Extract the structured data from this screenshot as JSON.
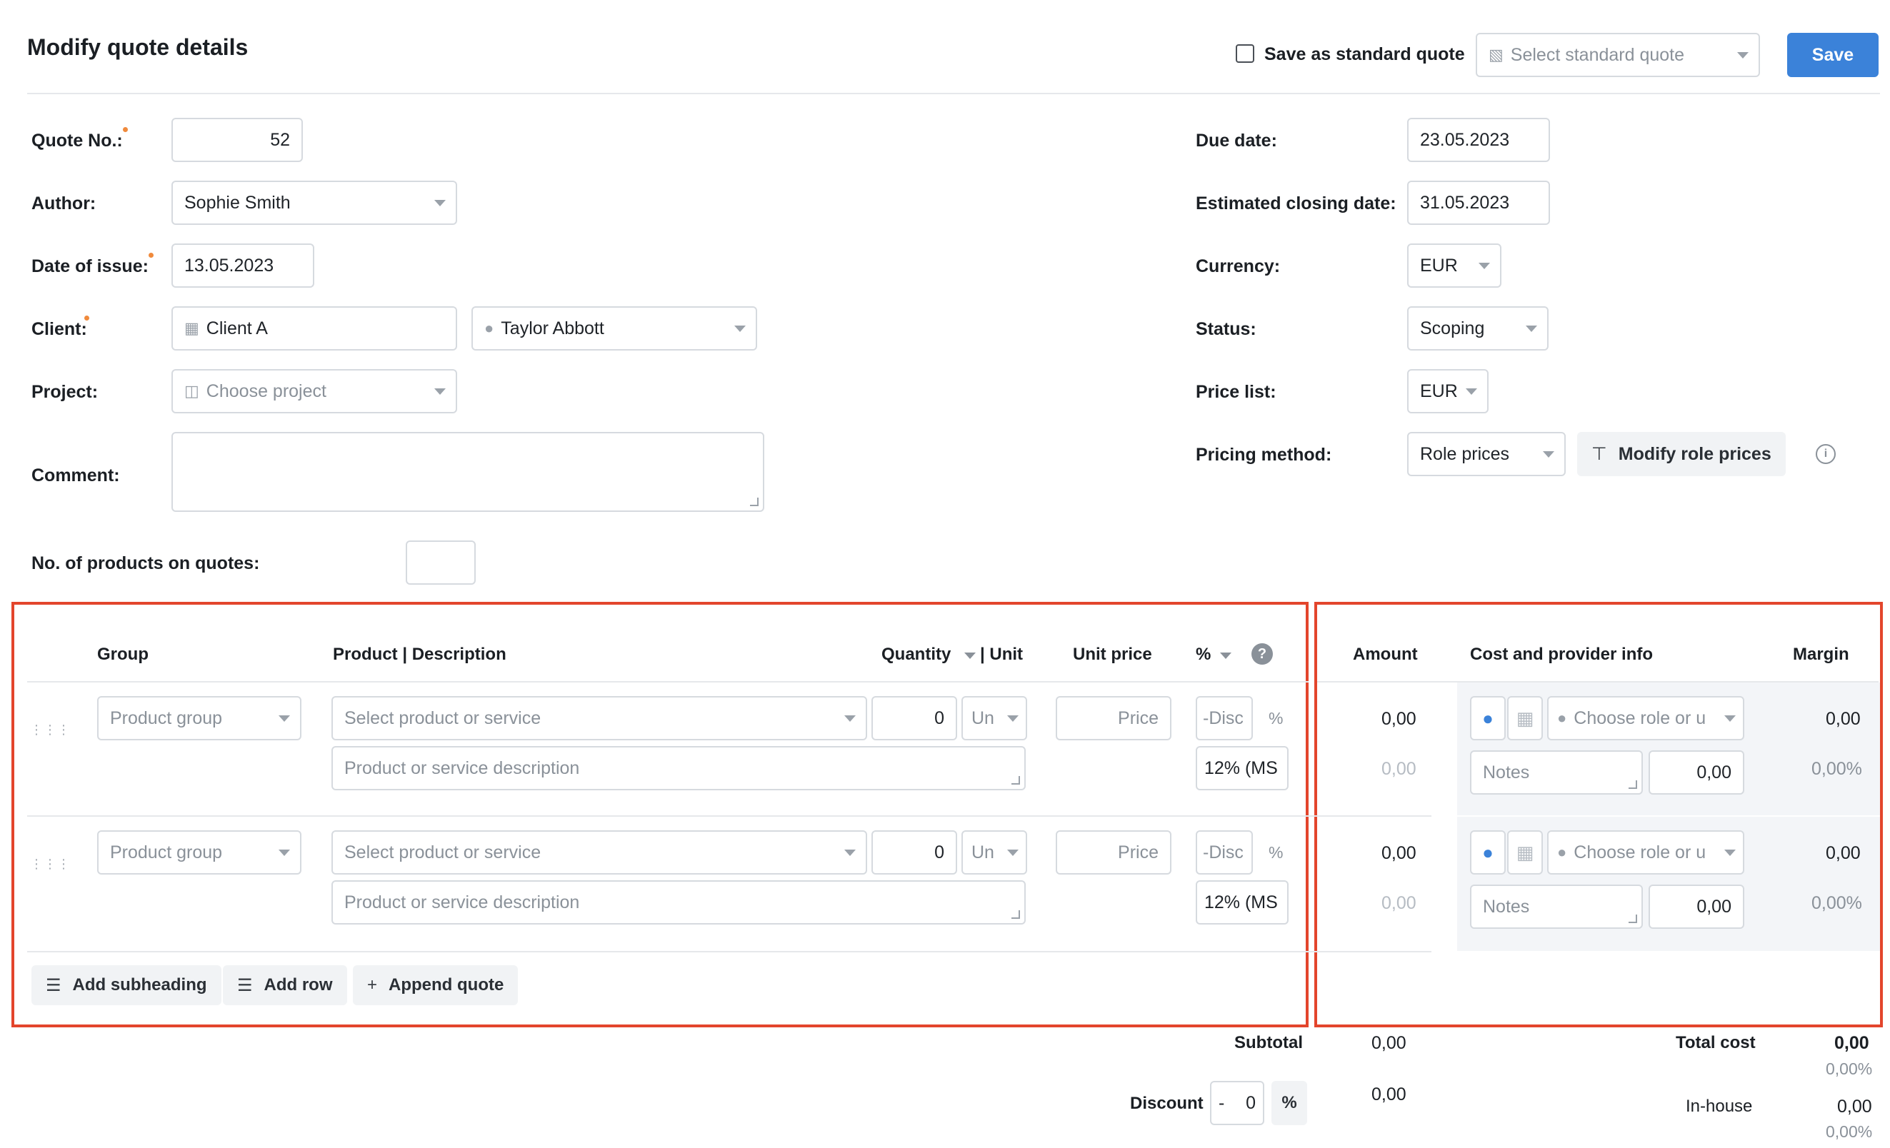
{
  "header": {
    "title": "Modify quote details",
    "save_standard_label": "Save as standard quote",
    "select_standard_placeholder": "Select standard quote",
    "save_label": "Save"
  },
  "form": {
    "quote_no_label": "Quote No.:",
    "quote_no_value": "52",
    "author_label": "Author:",
    "author_value": "Sophie Smith",
    "date_issue_label": "Date of issue:",
    "date_issue_value": "13.05.2023",
    "client_label": "Client:",
    "client_value": "Client A",
    "contact_value": "Taylor Abbott",
    "project_label": "Project:",
    "project_placeholder": "Choose project",
    "comment_label": "Comment:",
    "products_count_label": "No. of products on quotes:",
    "due_date_label": "Due date:",
    "due_date_value": "23.05.2023",
    "closing_date_label": "Estimated closing date:",
    "closing_date_value": "31.05.2023",
    "currency_label": "Currency:",
    "currency_value": "EUR",
    "status_label": "Status:",
    "status_value": "Scoping",
    "price_list_label": "Price list:",
    "price_list_value": "EUR",
    "pricing_method_label": "Pricing method:",
    "pricing_method_value": "Role prices",
    "modify_role_prices_label": "Modify role prices"
  },
  "table": {
    "headers": {
      "group": "Group",
      "product": "Product | Description",
      "quantity": "Quantity",
      "unit": "| Unit",
      "unit_price": "Unit price",
      "percent": "%",
      "help": "?",
      "amount": "Amount",
      "cost_info": "Cost and provider info",
      "margin": "Margin"
    },
    "rows": [
      {
        "group_placeholder": "Product group",
        "product_placeholder": "Select product or service",
        "quantity": "0",
        "unit_placeholder": "Un",
        "price_placeholder": "Price",
        "discount_placeholder": "-Disc",
        "percent_sign": "%",
        "description_placeholder": "Product or service description",
        "tax": "12% (MS",
        "amount": "0,00",
        "amount_sub": "0,00",
        "role_placeholder": "Choose role or u",
        "notes_placeholder": "Notes",
        "cost": "0,00",
        "margin": "0,00",
        "margin_pct": "0,00%"
      },
      {
        "group_placeholder": "Product group",
        "product_placeholder": "Select product or service",
        "quantity": "0",
        "unit_placeholder": "Un",
        "price_placeholder": "Price",
        "discount_placeholder": "-Disc",
        "percent_sign": "%",
        "description_placeholder": "Product or service description",
        "tax": "12% (MS",
        "amount": "0,00",
        "amount_sub": "0,00",
        "role_placeholder": "Choose role or u",
        "notes_placeholder": "Notes",
        "cost": "0,00",
        "margin": "0,00",
        "margin_pct": "0,00%"
      }
    ],
    "actions": {
      "add_subheading": "Add subheading",
      "add_row": "Add row",
      "append_quote": "Append quote"
    }
  },
  "totals": {
    "subtotal_label": "Subtotal",
    "subtotal_value": "0,00",
    "discount_label": "Discount",
    "discount_sign": "-",
    "discount_value": "0",
    "discount_unit": "%",
    "discount_amount": "0,00",
    "total_cost_label": "Total cost",
    "total_cost_value": "0,00",
    "total_cost_pct": "0,00%",
    "inhouse_label": "In-house",
    "inhouse_value": "0,00",
    "inhouse_pct": "0,00%"
  },
  "icons": {
    "building": "building-icon",
    "person": "person-icon",
    "briefcase": "briefcase-icon",
    "document": "document-icon",
    "drag": "drag-handle-icon",
    "list": "list-icon",
    "plus": "plus-icon",
    "info": "info-icon",
    "help": "help-icon"
  },
  "colors": {
    "accent": "#3b82d9",
    "highlight_frame": "#e3452c",
    "required_dot": "#f08a3c"
  }
}
